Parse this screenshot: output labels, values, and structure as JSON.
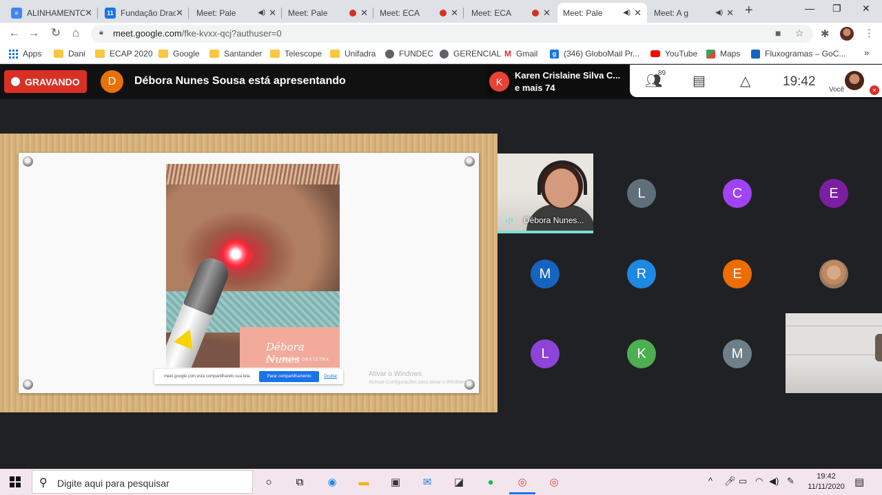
{
  "browser": {
    "tabs": [
      {
        "title": "ALINHAMENTO",
        "favicon": "docs-icon",
        "indicator": ""
      },
      {
        "title": "Fundação Drac",
        "favicon": "calendar-icon",
        "indicator": ""
      },
      {
        "title": "Meet: Pale",
        "favicon": "meet-icon",
        "indicator": "audio"
      },
      {
        "title": "Meet: Pale",
        "favicon": "meet-icon",
        "indicator": "recording"
      },
      {
        "title": "Meet: ECA",
        "favicon": "meet-icon",
        "indicator": "recording"
      },
      {
        "title": "Meet: ECA",
        "favicon": "meet-icon",
        "indicator": "recording"
      },
      {
        "title": "Meet: Pale",
        "favicon": "meet-icon",
        "indicator": "audio"
      },
      {
        "title": "Meet: A g",
        "favicon": "meet-icon",
        "indicator": "audio"
      }
    ],
    "active_tab": 6,
    "url_host": "meet.google.com",
    "url_path": "/fke-kvxx-qcj?authuser=0",
    "bookmarks": [
      {
        "label": "Apps",
        "icon": "apps-icon"
      },
      {
        "label": "Dani",
        "icon": "folder-icon"
      },
      {
        "label": "ECAP 2020",
        "icon": "folder-icon"
      },
      {
        "label": "Google",
        "icon": "folder-icon"
      },
      {
        "label": "Santander",
        "icon": "folder-icon"
      },
      {
        "label": "Telescope",
        "icon": "folder-icon"
      },
      {
        "label": "Unifadra",
        "icon": "folder-icon"
      },
      {
        "label": "FUNDEC",
        "icon": "globe-icon"
      },
      {
        "label": "GERENCIAL",
        "icon": "globe-icon"
      },
      {
        "label": "Gmail",
        "icon": "gmail-icon"
      },
      {
        "label": "(346) GloboMail Pr...",
        "icon": "globomail-icon"
      },
      {
        "label": "YouTube",
        "icon": "youtube-icon"
      },
      {
        "label": "Maps",
        "icon": "maps-icon"
      },
      {
        "label": "Fluxogramas – GoC...",
        "icon": "fluxogramas-icon"
      }
    ]
  },
  "meet": {
    "recording_label": "GRAVANDO",
    "presenter_initial": "D",
    "presenter_text": "Débora Nunes Sousa está apresentando",
    "notification": {
      "initial": "K",
      "line1": "Karen Crislaine Silva C...",
      "line2": "e mais 74"
    },
    "participant_count": "89",
    "time": "19:42",
    "self_label": "Você",
    "slide": {
      "card_name": "Débora Nunes",
      "card_subtitle": "ENFERMEIRA OBSTETRA",
      "share_text": "meet.google.com está compartilhando sua tela.",
      "stop_button": "Parar compartilhamento",
      "hide_link": "Ocultar",
      "activate_title": "Ativar o Windows",
      "activate_sub": "Acesse Configurações para ativar o Windows."
    },
    "self_tile_name": "Débora Nunes...",
    "participants": [
      {
        "initial": "L",
        "color": "#5f6f7a"
      },
      {
        "initial": "C",
        "color": "#a142f4"
      },
      {
        "initial": "E",
        "color": "#7b1fa2"
      },
      {
        "initial": "M",
        "color": "#1565c0"
      },
      {
        "initial": "R",
        "color": "#1e88e5"
      },
      {
        "initial": "E",
        "color": "#ef6c00"
      },
      {
        "initial": "L",
        "color": "#8e44d8"
      },
      {
        "initial": "K",
        "color": "#4caf50"
      },
      {
        "initial": "M",
        "color": "#6f7f8a"
      }
    ]
  },
  "taskbar": {
    "search_placeholder": "Digite aqui para pesquisar",
    "time": "19:42",
    "date": "11/11/2020"
  }
}
